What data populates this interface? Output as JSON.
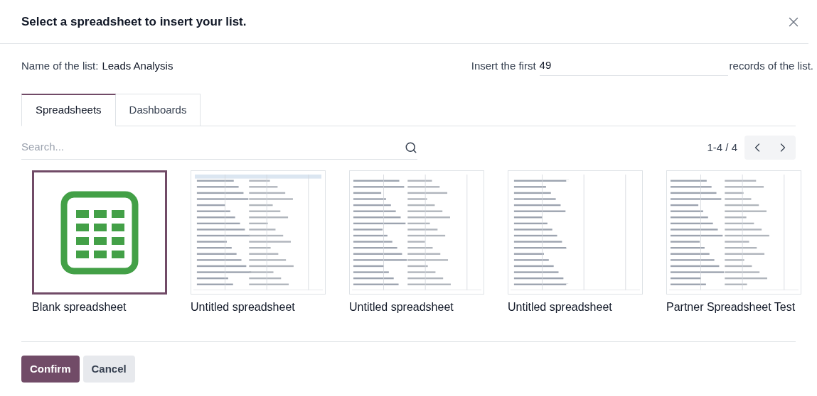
{
  "dialog": {
    "title": "Select a spreadsheet to insert your list."
  },
  "list_name": {
    "label": "Name of the list:",
    "value": "Leads Analysis"
  },
  "insert": {
    "label": "Insert the first",
    "value": "49",
    "suffix": "records of the list."
  },
  "tabs": [
    {
      "label": "Spreadsheets",
      "selected": true
    },
    {
      "label": "Dashboards",
      "selected": false
    }
  ],
  "search": {
    "placeholder": "Search..."
  },
  "pager": {
    "range": "1-4 / 4"
  },
  "items": [
    {
      "kind": "blank",
      "name": "Blank spreadsheet",
      "selected": true
    },
    {
      "kind": "sheet",
      "name": "Untitled spreadsheet",
      "selected": false
    },
    {
      "kind": "sheet",
      "name": "Untitled spreadsheet",
      "selected": false
    },
    {
      "kind": "sheet",
      "name": "Untitled spreadsheet",
      "selected": false
    },
    {
      "kind": "sheet",
      "name": "Partner Spreadsheet Test",
      "selected": false
    }
  ],
  "buttons": [
    {
      "label": "Confirm",
      "kind": "primary"
    },
    {
      "label": "Cancel",
      "kind": "secondary"
    }
  ]
}
